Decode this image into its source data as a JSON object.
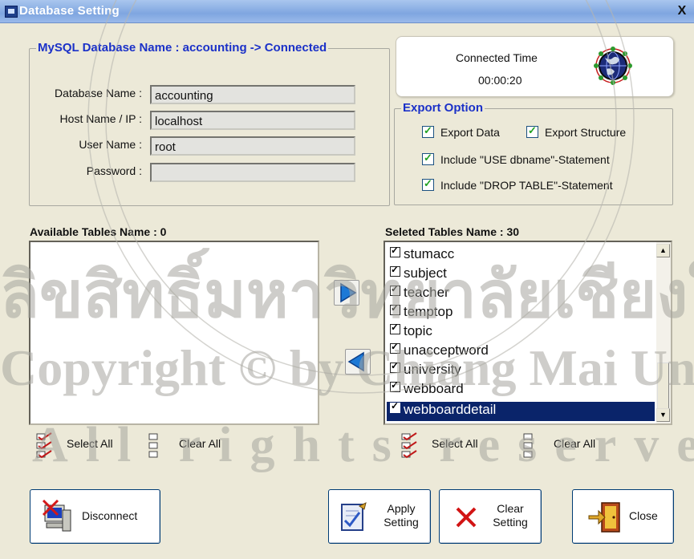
{
  "window": {
    "title": "Database Setting",
    "close_glyph": "X"
  },
  "db_group": {
    "legend": "MySQL Database Name : accounting -> Connected",
    "database_name_label": "Database Name :",
    "database_name_value": "accounting",
    "host_label": "Host Name / IP :",
    "host_value": "localhost",
    "user_label": "User Name :",
    "user_value": "root",
    "password_label": "Password :",
    "password_value": ""
  },
  "connection": {
    "caption": "Connected Time",
    "elapsed": "00:00:20",
    "icon": "globe-network-icon"
  },
  "export_option": {
    "legend": "Export Option",
    "export_data": "Export Data",
    "export_structure": "Export Structure",
    "include_use": "Include \"USE dbname\"-Statement",
    "include_drop": "Include \"DROP TABLE\"-Statement"
  },
  "available": {
    "title": "Available Tables Name : 0"
  },
  "selected": {
    "title": "Seleted Tables Name : 30",
    "items": [
      "stumacc",
      "subject",
      "teacher",
      "temptop",
      "topic",
      "unacceptword",
      "university",
      "webboard",
      "webboarddetail"
    ],
    "selected_item": "webboarddetail"
  },
  "bulk": {
    "left_select_all": "Select All",
    "left_clear_all": "Clear All",
    "right_select_all": "Select All",
    "right_clear_all": "Clear All"
  },
  "buttons": {
    "disconnect": "Disconnect",
    "apply_line1": "Apply",
    "apply_line2": "Setting",
    "clear_line1": "Clear",
    "clear_line2": "Setting",
    "close": "Close"
  },
  "colors": {
    "legend_blue": "#1b31c8",
    "selection": "#0a246a",
    "titlebar": "#7fa6e0"
  }
}
